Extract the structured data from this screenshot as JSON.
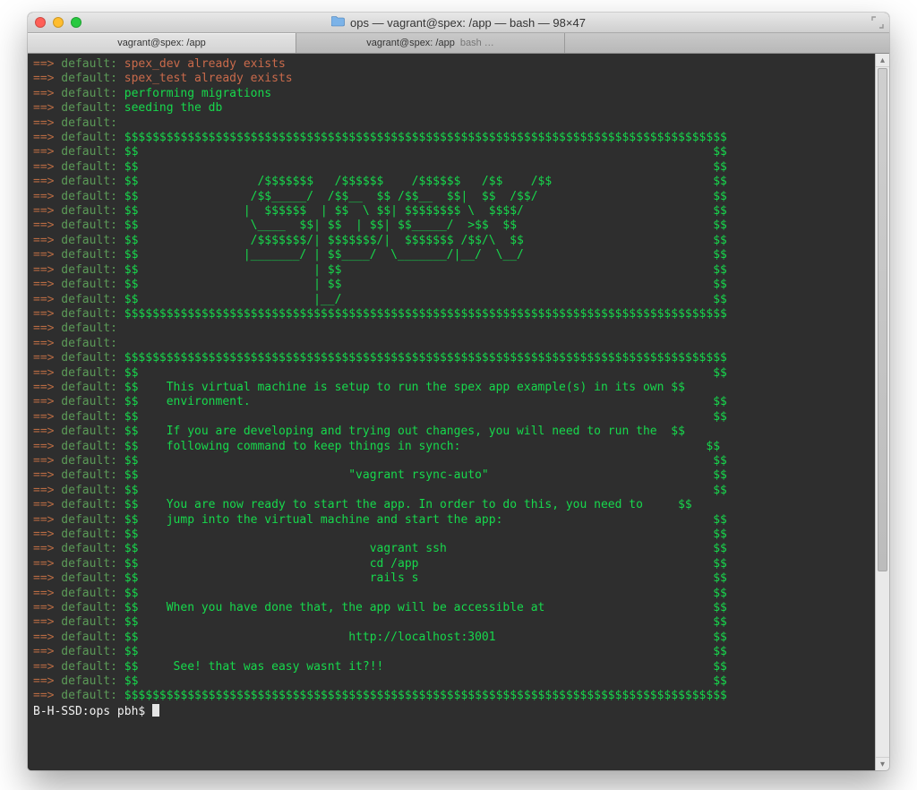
{
  "window": {
    "title": "ops — vagrant@spex: /app — bash — 98×47"
  },
  "tabs": [
    {
      "label": "vagrant@spex: /app",
      "sub": ""
    },
    {
      "label": "vagrant@spex: /app",
      "sub": "bash …"
    }
  ],
  "colors": {
    "arrow": "#b86b43",
    "label": "#5c9b58",
    "msg_red": "#c96a4b",
    "msg_green": "#17d84c",
    "prompt": "#f2f2f2",
    "bg": "#2e2e2e"
  },
  "prompt": "B-H-SSD:ops pbh$ ",
  "prefix_arrow": "==>",
  "prefix_label": " default: ",
  "lines": [
    {
      "color": "red",
      "text": "spex_dev already exists"
    },
    {
      "color": "red",
      "text": "spex_test already exists"
    },
    {
      "color": "green",
      "text": "performing migrations"
    },
    {
      "color": "green",
      "text": "seeding the db"
    },
    {
      "color": "green",
      "text": ""
    },
    {
      "color": "green",
      "text": "$$$$$$$$$$$$$$$$$$$$$$$$$$$$$$$$$$$$$$$$$$$$$$$$$$$$$$$$$$$$$$$$$$$$$$$$$$$$$$$$$$$$$$"
    },
    {
      "color": "green",
      "text": "$$                                                                                  $$"
    },
    {
      "color": "green",
      "text": "$$                                                                                  $$"
    },
    {
      "color": "green",
      "text": "$$                 /$$$$$$$   /$$$$$$    /$$$$$$   /$$    /$$                       $$"
    },
    {
      "color": "green",
      "text": "$$                /$$_____/  /$$__  $$ /$$__  $$|  $$  /$$/                         $$"
    },
    {
      "color": "green",
      "text": "$$               |  $$$$$$  | $$  \\ $$| $$$$$$$$ \\  $$$$/                           $$"
    },
    {
      "color": "green",
      "text": "$$                \\____  $$| $$  | $$| $$_____/  >$$  $$                            $$"
    },
    {
      "color": "green",
      "text": "$$                /$$$$$$$/| $$$$$$$/|  $$$$$$$ /$$/\\  $$                           $$"
    },
    {
      "color": "green",
      "text": "$$               |_______/ | $$____/  \\_______/|__/  \\__/                           $$"
    },
    {
      "color": "green",
      "text": "$$                         | $$                                                     $$"
    },
    {
      "color": "green",
      "text": "$$                         | $$                                                     $$"
    },
    {
      "color": "green",
      "text": "$$                         |__/                                                     $$"
    },
    {
      "color": "green",
      "text": "$$$$$$$$$$$$$$$$$$$$$$$$$$$$$$$$$$$$$$$$$$$$$$$$$$$$$$$$$$$$$$$$$$$$$$$$$$$$$$$$$$$$$$"
    },
    {
      "color": "green",
      "text": ""
    },
    {
      "color": "green",
      "text": ""
    },
    {
      "color": "green",
      "text": "$$$$$$$$$$$$$$$$$$$$$$$$$$$$$$$$$$$$$$$$$$$$$$$$$$$$$$$$$$$$$$$$$$$$$$$$$$$$$$$$$$$$$$"
    },
    {
      "color": "green",
      "text": "$$                                                                                  $$"
    },
    {
      "color": "green",
      "text": "$$    This virtual machine is setup to run the spex app example(s) in its own $$"
    },
    {
      "color": "green",
      "text": "$$    environment.                                                                  $$"
    },
    {
      "color": "green",
      "text": "$$                                                                                  $$"
    },
    {
      "color": "green",
      "text": "$$    If you are developing and trying out changes, you will need to run the  $$"
    },
    {
      "color": "green",
      "text": "$$    following command to keep things in synch:                                   $$"
    },
    {
      "color": "green",
      "text": "$$                                                                                  $$"
    },
    {
      "color": "green",
      "text": "$$                              \"vagrant rsync-auto\"                                $$"
    },
    {
      "color": "green",
      "text": "$$                                                                                  $$"
    },
    {
      "color": "green",
      "text": "$$    You are now ready to start the app. In order to do this, you need to     $$"
    },
    {
      "color": "green",
      "text": "$$    jump into the virtual machine and start the app:                              $$"
    },
    {
      "color": "green",
      "text": "$$                                                                                  $$"
    },
    {
      "color": "green",
      "text": "$$                                 vagrant ssh                                      $$"
    },
    {
      "color": "green",
      "text": "$$                                 cd /app                                          $$"
    },
    {
      "color": "green",
      "text": "$$                                 rails s                                          $$"
    },
    {
      "color": "green",
      "text": "$$                                                                                  $$"
    },
    {
      "color": "green",
      "text": "$$    When you have done that, the app will be accessible at                        $$"
    },
    {
      "color": "green",
      "text": "$$                                                                                  $$"
    },
    {
      "color": "green",
      "text": "$$                              http://localhost:3001                               $$"
    },
    {
      "color": "green",
      "text": "$$                                                                                  $$"
    },
    {
      "color": "green",
      "text": "$$     See! that was easy wasnt it?!!                                               $$"
    },
    {
      "color": "green",
      "text": "$$                                                                                  $$"
    },
    {
      "color": "green",
      "text": "$$$$$$$$$$$$$$$$$$$$$$$$$$$$$$$$$$$$$$$$$$$$$$$$$$$$$$$$$$$$$$$$$$$$$$$$$$$$$$$$$$$$$$"
    }
  ]
}
